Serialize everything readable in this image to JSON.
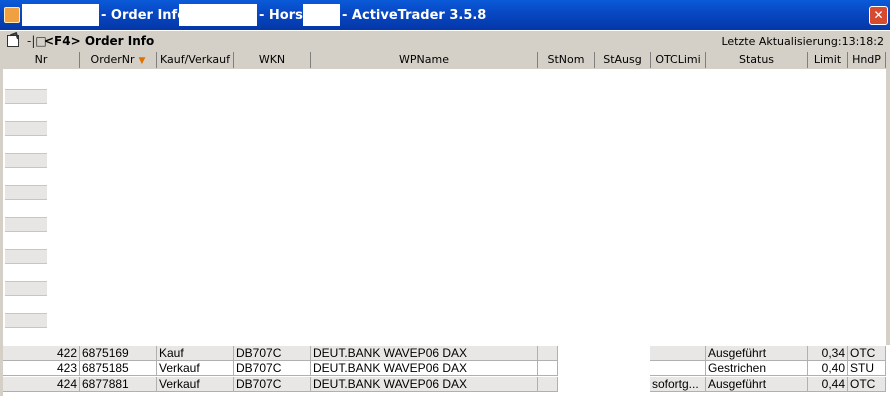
{
  "window": {
    "title_order_info": "- Order Info",
    "title_horst": "- Horst",
    "title_app": "- ActiveTrader 3.5.8"
  },
  "toolbar": {
    "pin_glyph": "-|□",
    "label": "<F4> Order Info",
    "last_update": "Letzte Aktualisierung:13:18:2"
  },
  "columns": [
    "Nr",
    "OrderNr",
    "Kauf/Verkauf",
    "WKN",
    "WPName",
    "StNom",
    "StAusg",
    "OTCLimi",
    "Status",
    "Limit",
    "HndP"
  ],
  "rows": [
    {
      "nr": "422",
      "order": "6875169",
      "side": "Kauf",
      "wkn": "DB707C",
      "name": "DEUT.BANK WAVEP06 DAX",
      "stnom": "",
      "stausg": "",
      "otc": "",
      "status": "Ausgeführt",
      "limit": "0,34",
      "hndp": "OTC"
    },
    {
      "nr": "423",
      "order": "6875185",
      "side": "Verkauf",
      "wkn": "DB707C",
      "name": "DEUT.BANK WAVEP06 DAX",
      "stnom": "",
      "stausg": "",
      "otc": "",
      "status": "Gestrichen",
      "limit": "0,40",
      "hndp": "STU"
    },
    {
      "nr": "424",
      "order": "6877881",
      "side": "Verkauf",
      "wkn": "DB707C",
      "name": "DEUT.BANK WAVEP06 DAX",
      "stnom": "",
      "stausg": "",
      "otc": "sofortg...",
      "status": "Ausgeführt",
      "limit": "0,44",
      "hndp": "OTC"
    }
  ]
}
